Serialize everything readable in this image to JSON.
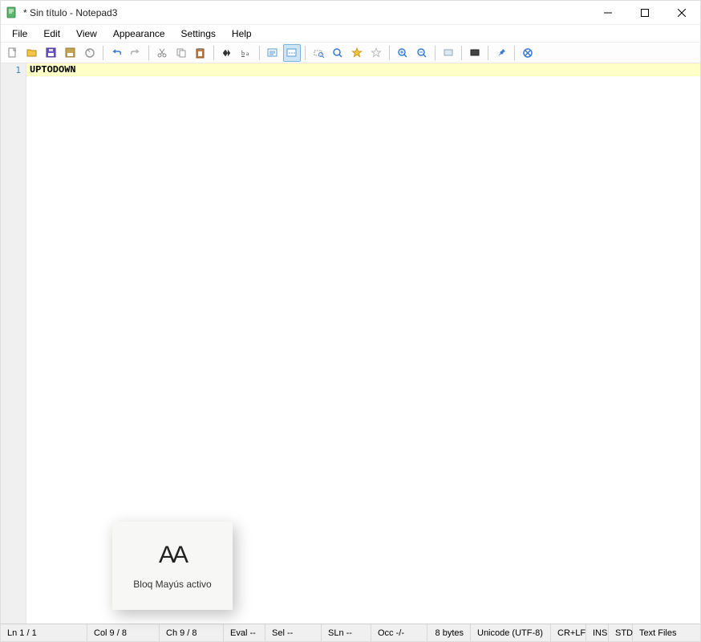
{
  "titlebar": {
    "title": "* Sin título - Notepad3"
  },
  "menubar": {
    "items": [
      "File",
      "Edit",
      "View",
      "Appearance",
      "Settings",
      "Help"
    ]
  },
  "editor": {
    "lines": [
      {
        "number": "1",
        "text": "UPTODOWN"
      }
    ]
  },
  "statusbar": {
    "ln": "Ln  1 / 1",
    "col": "Col  9 / 8",
    "ch": "Ch  9 / 8",
    "eval": "Eval  --",
    "sel": "Sel  --",
    "sln": "SLn  --",
    "occ": "Occ  -/-",
    "bytes": "8 bytes",
    "encoding": "Unicode (UTF-8)",
    "eol": "CR+LF",
    "ins": "INS",
    "std": "STD",
    "filetype": "Text Files"
  },
  "caps_popup": {
    "icon": "AA",
    "text": "Bloq Mayús activo"
  },
  "icons": {
    "new": "new-file-icon",
    "open": "open-folder-icon",
    "save": "save-icon",
    "saveas": "save-as-icon",
    "revert": "revert-icon",
    "undo": "undo-icon",
    "redo": "redo-icon",
    "cut": "cut-icon",
    "copy": "copy-icon",
    "paste": "paste-icon",
    "find": "find-icon",
    "replace": "replace-icon",
    "wordwrap": "word-wrap-icon",
    "whitespace": "show-whitespace-icon",
    "zoomsel": "zoom-selection-icon",
    "zoomfit": "zoom-fit-icon",
    "favorite": "favorite-icon",
    "addfav": "add-favorite-icon",
    "zoomin": "zoom-in-icon",
    "zoomout": "zoom-out-icon",
    "schemes": "schemes-icon",
    "config": "config-icon",
    "pin": "pin-icon",
    "exit": "exit-icon"
  }
}
